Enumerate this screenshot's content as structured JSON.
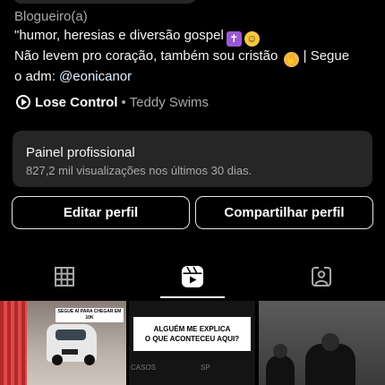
{
  "profile": {
    "category": "Blogueiro(a)",
    "bio_line1": "\"humor, heresias e diversão gospel",
    "bio_line2": "Não levem pro coração, também sou cristão",
    "bio_line2_suffix": "| Segue",
    "bio_line3_prefix": "o adm:",
    "bio_link": "@eonicanor",
    "emoji_names": [
      "latin-cross-emoji",
      "laughing-tears-emoji",
      "raised-hands-emoji"
    ]
  },
  "music": {
    "icon": "play-circle-icon",
    "song": "Lose Control",
    "separator": "•",
    "artist": "Teddy Swims"
  },
  "professional_panel": {
    "title": "Painel profissional",
    "subtitle": "827,2 mil visualizações nos últimos 30 dias."
  },
  "buttons": {
    "edit": "Editar perfil",
    "share": "Compartilhar perfil"
  },
  "tabs": [
    {
      "icon": "grid-icon",
      "active": false
    },
    {
      "icon": "reels-icon",
      "active": true
    },
    {
      "icon": "tagged-person-icon",
      "active": false
    }
  ],
  "posts": [
    {
      "caption": "SEGUE AÍ PARA CHEGAR EM 10K"
    },
    {
      "caption_line1": "ALGUÉM ME EXPLICA",
      "caption_line2": "O QUE ACONTECEU AQUI?",
      "overlay_left": "CASOS",
      "overlay_right": "SP"
    },
    {
      "caption": ""
    }
  ],
  "colors": {
    "background": "#000000",
    "panel": "#262626",
    "secondary_text": "#a8a8a8",
    "link": "#e0f1ff"
  }
}
